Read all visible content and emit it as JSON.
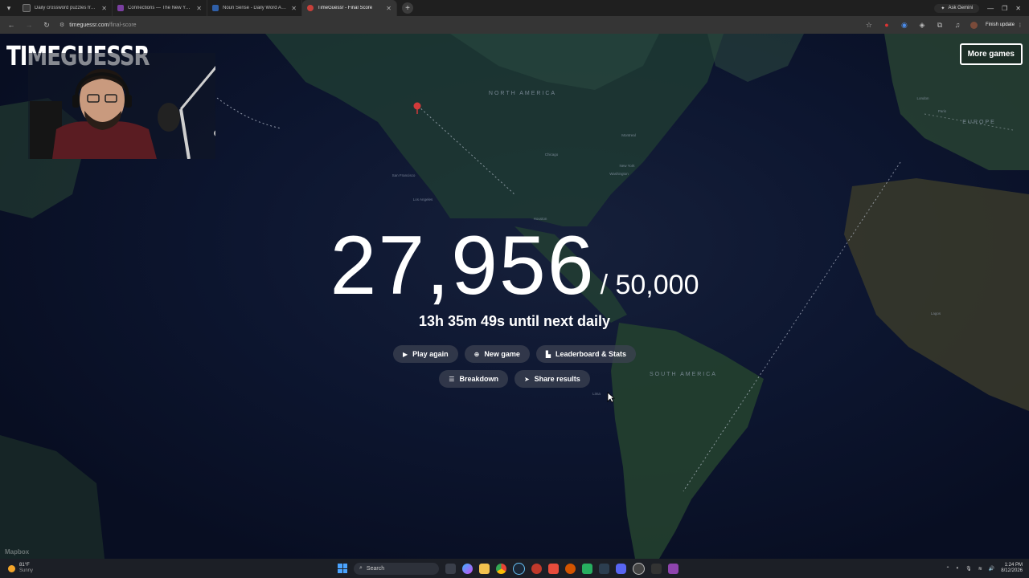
{
  "browser": {
    "tabs": [
      {
        "title": "Daily crossword puzzles free fr...",
        "color": "#3a3a3a",
        "active": false
      },
      {
        "title": "Connections — The New York...",
        "color": "#7a3fa0",
        "active": false
      },
      {
        "title": "Noun Sense - Daily Word Asso...",
        "color": "#2f5fa8",
        "active": false
      },
      {
        "title": "TimeGuessr - Final Score",
        "color": "#c8403a",
        "active": true
      }
    ],
    "ask_gemini": "Ask Gemini",
    "url_host": "timeguessr.com",
    "url_path": "/final-score",
    "finish_update": "Finish update"
  },
  "site": {
    "logo": "TIMEGUESSR",
    "more_games": "More games"
  },
  "result": {
    "score": "27,956",
    "max": "/ 50,000",
    "countdown": "13h 35m 49s until next daily"
  },
  "buttons": {
    "play_again": "Play again",
    "new_game": "New game",
    "leaderboard": "Leaderboard & Stats",
    "breakdown": "Breakdown",
    "share": "Share results"
  },
  "map_labels": {
    "north_america": "NORTH AMERICA",
    "south_america": "SOUTH AMERICA",
    "europe": "EUROPE",
    "cities": [
      "San Francisco",
      "Los Angeles",
      "Chicago",
      "New York",
      "Washington",
      "Houston",
      "Montreal",
      "Lima",
      "London",
      "Lagos",
      "Paris"
    ]
  },
  "attribution": "Mapbox",
  "taskbar": {
    "temp": "81°F",
    "weather": "Sunny",
    "search": "Search",
    "time": "1:24 PM",
    "date": "8/12/2026"
  }
}
